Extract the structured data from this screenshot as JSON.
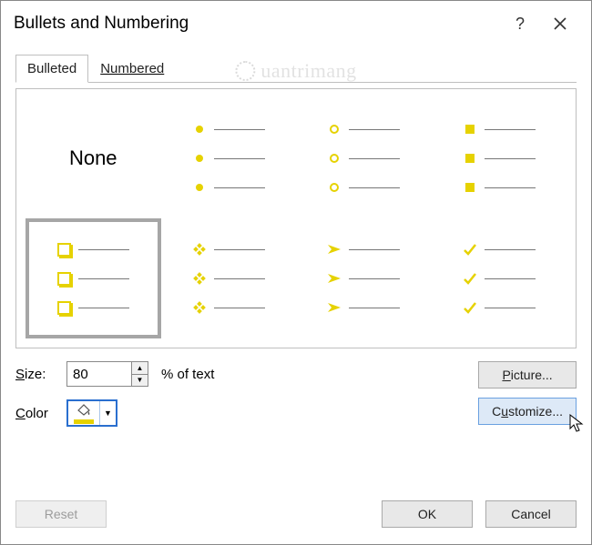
{
  "title": "Bullets and Numbering",
  "tabs": {
    "bulleted": "Bulleted",
    "numbered": "Numbered"
  },
  "gallery": {
    "none_label": "None",
    "styles": [
      "none",
      "disc",
      "circle",
      "square",
      "box",
      "diamond",
      "arrow",
      "check"
    ],
    "selected_index": 4
  },
  "size": {
    "label": "Size:",
    "value": "80",
    "suffix": "% of text"
  },
  "color": {
    "label": "Color",
    "value": "#e6d200"
  },
  "buttons": {
    "picture": "Picture...",
    "customize": "Customize...",
    "reset": "Reset",
    "ok": "OK",
    "cancel": "Cancel"
  },
  "watermark": "uantrimang"
}
